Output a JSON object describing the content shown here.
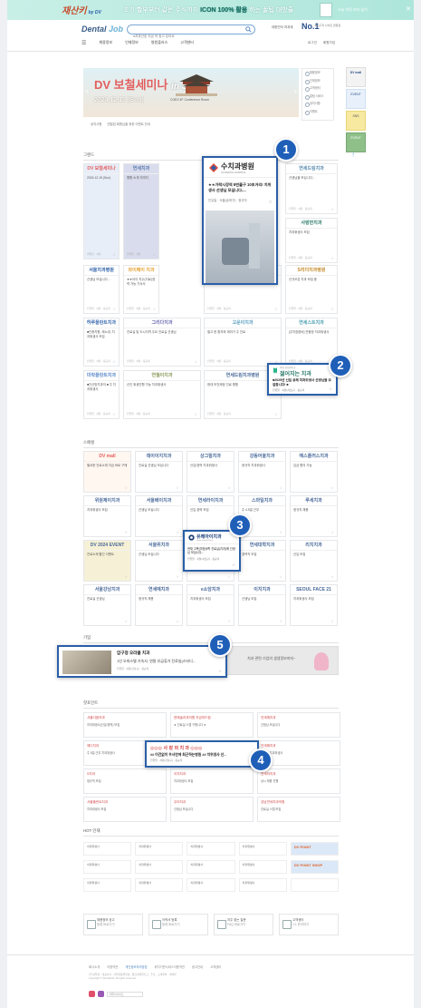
{
  "top_banner": {
    "logo": "재산키",
    "logo_suffix": "by DV",
    "message_prefix": "초기 할부부터 같은 주식까지",
    "message_highlight": "ICON 100% 활용",
    "message_suffix": "하는 꿀팁 대방출",
    "dismiss": "오늘 하루 보지 않기",
    "close": "✕"
  },
  "header": {
    "logo_main": "Dental",
    "logo_accent": "Job",
    "search_placeholder": "#치과간호 지금 딱 찾고 있어요",
    "rank_text": "대한민국 치과계",
    "rank_no1": "No.1",
    "rank_sub": "구인구직 사이트 덴탈잡"
  },
  "nav": {
    "menu_icon": "☰",
    "items": [
      "채용정보",
      "인재정보",
      "병원플러스",
      "고객센터"
    ],
    "user_items": [
      "로그인",
      "회원가입"
    ]
  },
  "hero": {
    "title": "DV 보철세미나",
    "title_accent": "in Seoul",
    "date": "2024.12.15 (Sun)",
    "venue": "COEX 4F Conference Room",
    "caption": [
      "공지사항",
      "덴탈잡 회원님을 위한 이벤트 안내"
    ],
    "prev": "‹",
    "next": "›",
    "menu": [
      "채용정보",
      "인재정보",
      "고객센터",
      "알림 서비스",
      "공지사항",
      "이벤트"
    ]
  },
  "side_ads": [
    "DV mall",
    "EVENT",
    "SNS",
    "EVENT"
  ],
  "sections": {
    "grand": "그랜드",
    "special": "스페셜",
    "company": "기업",
    "hot_point": "핫포인트",
    "hot_talent": "HOT 인재"
  },
  "scroll_top": "↑",
  "callouts": [
    {
      "number": "1",
      "hospital": "수치과병원",
      "hospital_sub": "SU DENTAL HOSPITAL",
      "desc": "★★가락시장역 8번출구 10초거리! 치위생사 선생님 모십니다....",
      "meta": "인유일 · 서울(송파구) · 정규직",
      "fav": "☆"
    },
    {
      "number": "2",
      "hospital": "젊어지는 치과",
      "hospital_sub": "이제, 당신만의 곳",
      "desc": "■2025년 신입 공채 치과위생사 선생님을 모집합니다! ■",
      "meta": "인유일 · 서울(서초구) · 정규직",
      "fav": "☆"
    },
    {
      "number": "3",
      "hospital": "유쾌아이치과",
      "hospital_sub": "Smile Dental Clinic",
      "desc": "현재 고목(미정)5학 진료실(치과)에 선생님 모십니다...",
      "meta": "인유일 · 서울(서초구) · 정규직",
      "fav": "☆"
    },
    {
      "number": "4",
      "hospital": "◎◎◎ 사 랑 의 치 과 ◎◎◎",
      "desc": "## 이건없이 우사연에 최근하는병원 ## 치위생사 선...",
      "meta": "인유일 · 서울(강남구) · 정규직",
      "fav": "☆"
    },
    {
      "number": "5",
      "hospital": "압구정 오라클 치과",
      "desc": "1인 오피스텔 기숙사, 연말 유급휴가 진료실(스터디...",
      "meta": "인유일 · 서울(강남구) · 정규직",
      "fav": "☆"
    }
  ],
  "grand_cards": [
    {
      "name": "DV 보철세미나",
      "desc": "2024.12.15 (Sun)",
      "meta": "덴탈잡 · 서울"
    },
    {
      "name": "연세치과",
      "desc": "병원 소개 이미지",
      "meta": "인유일 · 서울"
    },
    {
      "name": "연세드림치과",
      "desc": "선생님을 모십니다...",
      "meta": "인유일 · 서울 · 정규직"
    },
    {
      "name": "사랑한치과",
      "desc": "치과위생사 모집",
      "meta": "인유일 · 서울 · 정규직"
    },
    {
      "name": "서울치과병원",
      "desc": "선생님 모십니다...",
      "meta": "인유일 · 서울 · 정규직"
    },
    {
      "name": "와이페이 치과",
      "desc": "★★아이 치수(치료)경력 가능 기숙사",
      "meta": "인유일 · 서울 · 정규직"
    },
    {
      "name": "더미소치과",
      "desc": "■산업(경력) 모집 ■",
      "meta": "인유일 · 서울 · 정규직"
    },
    {
      "name": "S리더치과병원",
      "desc": "신규오픈 치과 모집 중",
      "meta": "인유일 · 서울 · 정규직"
    },
    {
      "name": "하루플란트치과",
      "desc": "■인증치원, 재노대, 치과위생사 모집",
      "meta": "인유일 · 서울 · 정규직"
    },
    {
      "name": "그리다치과",
      "desc": "진료실 및 도시지역 주요 진료실 선생님",
      "meta": "인유일 · 서울 · 정규직"
    },
    {
      "name": "고운이치과",
      "desc": "멀고 한 환자와 재미가 주 진료",
      "meta": "인유일 · 서울 · 정규직"
    },
    {
      "name": "연세스트치과",
      "desc": "[주차장완비] 연중방 치과위생사",
      "meta": "인유일 · 서울 · 정규직"
    },
    {
      "name": "미락플란트치과",
      "desc": "■인산방치과의 ■ 주 치과위생사",
      "meta": "인유일 · 서울 · 정규직"
    },
    {
      "name": "연월이치과",
      "desc": "신인 위생진행 가능 치과위생사",
      "meta": "인유일 · 서울 · 정규직"
    },
    {
      "name": "연세드림치과병원",
      "desc": "현대 보건제정 진료 병원",
      "meta": "인유일 · 서울 · 정규직"
    }
  ],
  "special_cards": [
    {
      "name": "DV mall",
      "desc": "필요한 진료소재 지금 바로 구매"
    },
    {
      "name": "데이이지치과",
      "desc": "진료실 선생님 모십니다"
    },
    {
      "name": "상그릴치과",
      "desc": "신입/경력 치과위생사"
    },
    {
      "name": "강동어울치과",
      "desc": "정규직 치과위생사"
    },
    {
      "name": "예스플러스치과",
      "desc": "임금 협의 가능"
    },
    {
      "name": "위원제이치과",
      "desc": "치과위생사 모집"
    },
    {
      "name": "서울베이치과",
      "desc": "선생님 모십니다"
    },
    {
      "name": "연세라이치과",
      "desc": "신입 경력 모집"
    },
    {
      "name": "스마일치과",
      "desc": "주 4.5일 근무"
    },
    {
      "name": "루세치과",
      "desc": "정규직 채용"
    },
    {
      "name": "DV 2024 EVENT",
      "desc": "진료소재 할인 이벤트"
    },
    {
      "name": "서울위치과",
      "desc": "선생님 모십니다"
    },
    {
      "name": "하이미치과",
      "desc": "치과위생사 모집"
    },
    {
      "name": "연세대학치과",
      "desc": "경력직 모집"
    },
    {
      "name": "리치치과",
      "desc": "신입 모집"
    },
    {
      "name": "서울강남치과",
      "desc": "진료실 선생님"
    },
    {
      "name": "연세예치과",
      "desc": "정규직 채용"
    },
    {
      "name": "e소담치과",
      "desc": "치과위생사 모집"
    },
    {
      "name": "이지치과",
      "desc": "선생님 모집"
    },
    {
      "name": "SEOUL FACE 21",
      "desc": "치과위생사 모집"
    }
  ],
  "company_banner": "치과 관련 기업의 생생정보까지~",
  "hot_point_cards": [
    {
      "name": "서울다음치과",
      "desc": "치과위생사(신입/경력) 모집"
    },
    {
      "name": "한예솔치과의원 자금미드점",
      "desc": "★ 진료실 스텝 구합니다 ★"
    },
    {
      "name": "연세예치과",
      "desc": "선생님 모십니다"
    },
    {
      "name": "메디치과",
      "desc": "주 5일 근무 치과위생사"
    },
    {
      "name": "해마루치과",
      "desc": "기숙사 제공 치과위생사"
    },
    {
      "name": "연세해치과",
      "desc": "진료실 치과위생사"
    },
    {
      "name": "S치과",
      "desc": "정규직 모집"
    },
    {
      "name": "이지치과",
      "desc": "치과위생사 모집"
    },
    {
      "name": "연세미치과",
      "desc": "상시 채용 진행"
    },
    {
      "name": "서울플란트치과",
      "desc": "치과위생사 모집"
    },
    {
      "name": "우리치과",
      "desc": "선생님 모십니다"
    },
    {
      "name": "강남연세치과의원",
      "desc": "진료실 스텝 모집"
    }
  ],
  "hot_talent": [
    [
      "치과위생사",
      "치과위생사",
      "치과위생사",
      "치과위생사",
      "DV POINT"
    ],
    [
      "치과위생사",
      "치과위생사",
      "치과위생사",
      "치과위생사",
      "DV POINT SHOP"
    ],
    [
      "치과위생사",
      "치과위생사",
      "치과위생사",
      "치과위생사",
      ""
    ]
  ],
  "bottom_boxes": [
    {
      "title": "채용정보 공고",
      "sub": "등록 바로가기"
    },
    {
      "title": "이력서 등록",
      "sub": "등록 바로가기"
    },
    {
      "title": "자주 찾는 질문",
      "sub": "FAQ 바로가기"
    },
    {
      "title": "고객센터",
      "sub": "1:1 문의하기"
    }
  ],
  "footer": {
    "links": [
      "회사소개",
      "이용약관",
      "개인정보처리방침",
      "위치기반서비스이용약관",
      "광고안내",
      "고객센터"
    ],
    "info": "(주)덴탈잡 · 대표이사 · 사업자등록번호 · 통신판매업신고 · 주소 · 고객센터 · 이메일",
    "copyright": "Copyright © DentalJob. All rights reserved.",
    "family_site": "패밀리사이트"
  },
  "colors": {
    "accent": "#1f5fb8",
    "banner": "#aee6db",
    "hero_title": "#e35f5f"
  }
}
